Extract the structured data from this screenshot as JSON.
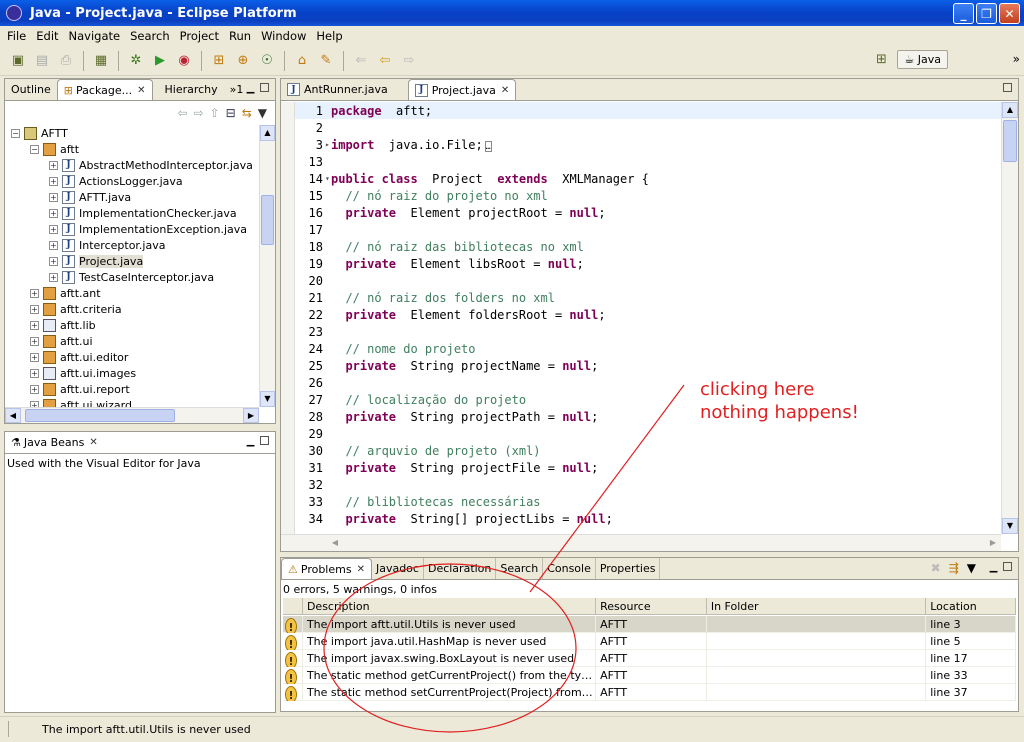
{
  "window": {
    "title": "Java - Project.java - Eclipse Platform"
  },
  "menu": [
    "File",
    "Edit",
    "Navigate",
    "Search",
    "Project",
    "Run",
    "Window",
    "Help"
  ],
  "perspective": {
    "label": "Java"
  },
  "left_panel": {
    "tabs": [
      "Outline",
      "Package...",
      "Hierarchy",
      "»1"
    ],
    "tree": [
      {
        "label": "AFTT",
        "indent": 0,
        "kind": "proj",
        "exp": "−"
      },
      {
        "label": "aftt",
        "indent": 1,
        "kind": "pkg",
        "exp": "−"
      },
      {
        "label": "AbstractMethodInterceptor.java",
        "indent": 2,
        "kind": "jfile",
        "exp": "+"
      },
      {
        "label": "ActionsLogger.java",
        "indent": 2,
        "kind": "jfile",
        "exp": "+"
      },
      {
        "label": "AFTT.java",
        "indent": 2,
        "kind": "jfile",
        "exp": "+"
      },
      {
        "label": "ImplementationChecker.java",
        "indent": 2,
        "kind": "jfile",
        "exp": "+"
      },
      {
        "label": "ImplementationException.java",
        "indent": 2,
        "kind": "jfile",
        "exp": "+"
      },
      {
        "label": "Interceptor.java",
        "indent": 2,
        "kind": "jfile",
        "exp": "+"
      },
      {
        "label": "Project.java",
        "indent": 2,
        "kind": "jfile",
        "exp": "+",
        "selected": true
      },
      {
        "label": "TestCaseInterceptor.java",
        "indent": 2,
        "kind": "jfile",
        "exp": "+"
      },
      {
        "label": "aftt.ant",
        "indent": 1,
        "kind": "pkg",
        "exp": "+"
      },
      {
        "label": "aftt.criteria",
        "indent": 1,
        "kind": "pkg",
        "exp": "+"
      },
      {
        "label": "aftt.lib",
        "indent": 1,
        "kind": "lib",
        "exp": "+"
      },
      {
        "label": "aftt.ui",
        "indent": 1,
        "kind": "pkg",
        "exp": "+"
      },
      {
        "label": "aftt.ui.editor",
        "indent": 1,
        "kind": "pkg",
        "exp": "+"
      },
      {
        "label": "aftt.ui.images",
        "indent": 1,
        "kind": "lib",
        "exp": "+"
      },
      {
        "label": "aftt.ui.report",
        "indent": 1,
        "kind": "pkg",
        "exp": "+"
      },
      {
        "label": "aftt.ui.wizard",
        "indent": 1,
        "kind": "pkg",
        "exp": "+"
      }
    ]
  },
  "beans_panel": {
    "tab": "Java Beans",
    "text": "Used with the Visual Editor for Java"
  },
  "editor": {
    "tabs": [
      "AntRunner.java",
      "Project.java"
    ],
    "lines": [
      {
        "n": "1",
        "segs": [
          [
            "kw",
            "package"
          ],
          [
            "",
            "  aftt;"
          ]
        ],
        "hl": true
      },
      {
        "n": "2",
        "segs": []
      },
      {
        "n": "3",
        "fold": "▸",
        "segs": [
          [
            "kw",
            "import"
          ],
          [
            "",
            "  java.io.File;"
          ],
          [
            "box",
            "…"
          ]
        ]
      },
      {
        "n": "13",
        "segs": []
      },
      {
        "n": "14",
        "fold": "▾",
        "segs": [
          [
            "kw",
            "public class"
          ],
          [
            "",
            "  Project  "
          ],
          [
            "kw",
            "extends"
          ],
          [
            "",
            "  XMLManager {"
          ]
        ]
      },
      {
        "n": "15",
        "segs": [
          [
            "cm",
            "  // nó raiz do projeto no xml"
          ]
        ]
      },
      {
        "n": "16",
        "segs": [
          [
            "",
            "  "
          ],
          [
            "kw",
            "private"
          ],
          [
            "",
            "  Element projectRoot = "
          ],
          [
            "kw",
            "null"
          ],
          [
            "",
            ";"
          ]
        ]
      },
      {
        "n": "17",
        "segs": []
      },
      {
        "n": "18",
        "segs": [
          [
            "cm",
            "  // nó raiz das bibliotecas no xml"
          ]
        ]
      },
      {
        "n": "19",
        "segs": [
          [
            "",
            "  "
          ],
          [
            "kw",
            "private"
          ],
          [
            "",
            "  Element libsRoot = "
          ],
          [
            "kw",
            "null"
          ],
          [
            "",
            ";"
          ]
        ]
      },
      {
        "n": "20",
        "segs": []
      },
      {
        "n": "21",
        "segs": [
          [
            "cm",
            "  // nó raiz dos folders no xml"
          ]
        ]
      },
      {
        "n": "22",
        "segs": [
          [
            "",
            "  "
          ],
          [
            "kw",
            "private"
          ],
          [
            "",
            "  Element foldersRoot = "
          ],
          [
            "kw",
            "null"
          ],
          [
            "",
            ";"
          ]
        ]
      },
      {
        "n": "23",
        "segs": []
      },
      {
        "n": "24",
        "segs": [
          [
            "cm",
            "  // nome do projeto"
          ]
        ]
      },
      {
        "n": "25",
        "segs": [
          [
            "",
            "  "
          ],
          [
            "kw",
            "private"
          ],
          [
            "",
            "  String projectName = "
          ],
          [
            "kw",
            "null"
          ],
          [
            "",
            ";"
          ]
        ]
      },
      {
        "n": "26",
        "segs": []
      },
      {
        "n": "27",
        "segs": [
          [
            "cm",
            "  // localização do projeto"
          ]
        ]
      },
      {
        "n": "28",
        "segs": [
          [
            "",
            "  "
          ],
          [
            "kw",
            "private"
          ],
          [
            "",
            "  String projectPath = "
          ],
          [
            "kw",
            "null"
          ],
          [
            "",
            ";"
          ]
        ]
      },
      {
        "n": "29",
        "segs": []
      },
      {
        "n": "30",
        "segs": [
          [
            "cm",
            "  // arquvio de projeto (xml)"
          ]
        ]
      },
      {
        "n": "31",
        "segs": [
          [
            "",
            "  "
          ],
          [
            "kw",
            "private"
          ],
          [
            "",
            "  String projectFile = "
          ],
          [
            "kw",
            "null"
          ],
          [
            "",
            ";"
          ]
        ]
      },
      {
        "n": "32",
        "segs": []
      },
      {
        "n": "33",
        "segs": [
          [
            "cm",
            "  // blibliotecas necessárias"
          ]
        ]
      },
      {
        "n": "34",
        "segs": [
          [
            "",
            "  "
          ],
          [
            "kw",
            "private"
          ],
          [
            "",
            "  String[] projectLibs = "
          ],
          [
            "kw",
            "null"
          ],
          [
            "",
            ";"
          ]
        ]
      }
    ]
  },
  "problems": {
    "tabs": [
      "Problems",
      "Javadoc",
      "Declaration",
      "Search",
      "Console",
      "Properties"
    ],
    "summary": "0 errors, 5 warnings, 0 infos",
    "columns": [
      "",
      "Description",
      "Resource",
      "In Folder",
      "Location"
    ],
    "rows": [
      {
        "desc": "The import aftt.util.Utils is never used",
        "res": "AFTT",
        "folder": "",
        "loc": "line 3",
        "selected": true
      },
      {
        "desc": "The import java.util.HashMap is never used",
        "res": "AFTT",
        "folder": "",
        "loc": "line 5"
      },
      {
        "desc": "The import javax.swing.BoxLayout is never used",
        "res": "AFTT",
        "folder": "",
        "loc": "line 17"
      },
      {
        "desc": "The static method getCurrentProject() from the type Pr...",
        "res": "AFTT",
        "folder": "",
        "loc": "line 33"
      },
      {
        "desc": "The static method setCurrentProject(Project) from the t...",
        "res": "AFTT",
        "folder": "",
        "loc": "line 37"
      }
    ]
  },
  "status": "The import aftt.util.Utils is never used",
  "annotation": {
    "line1": "clicking here",
    "line2": "nothing happens!",
    "color": "#E02020"
  }
}
